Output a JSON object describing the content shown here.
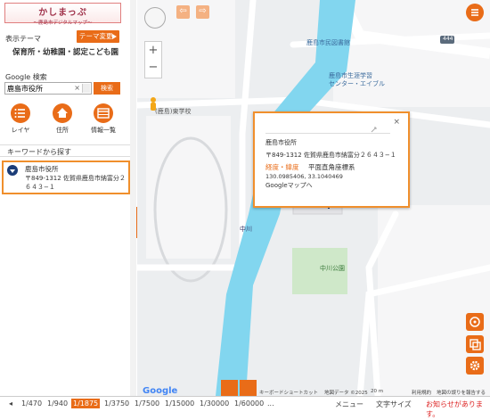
{
  "app": {
    "logo_title": "かしまっぷ",
    "logo_subtitle": "〜鹿島市デジタルマップ〜"
  },
  "sidebar": {
    "theme_label": "表示テーマ",
    "theme_button": "テーマ変更",
    "theme_name": "保育所・幼稚園・認定こども園",
    "google_search_label": "Google 検索",
    "search_value": "鹿島市役所",
    "search_button": "検索",
    "tools": [
      {
        "label": "レイヤ",
        "icon": "list-icon"
      },
      {
        "label": "住所",
        "icon": "home-icon"
      },
      {
        "label": "情報一覧",
        "icon": "table-icon"
      }
    ],
    "keyword_header": "キーワードから探す",
    "result": {
      "name": "鹿島市役所",
      "address": "〒849-1312 佐賀県鹿島市納富分２６４３−１"
    }
  },
  "map": {
    "labels": {
      "library": "鹿島市民図書館",
      "lifelong": "鹿島市生涯学習",
      "lifelong2": "センター・エイブル",
      "school": "(鹿島)東学校",
      "river": "中川",
      "park": "中川公園",
      "route": "444",
      "river_label": "中川"
    },
    "popup": {
      "title": "鹿島市役所",
      "address": "〒849-1312 佐賀県鹿島市納富分２６４３−１",
      "latlon_label": "経度・緯度",
      "coord_system": "平面直角座標系",
      "coords": "130.0985406, 33.1040469",
      "google_link": "Googleマップへ"
    },
    "attribution": {
      "shortcuts": "キーボードショートカット",
      "mapdata": "地図データ ©2025",
      "scale": "20 m",
      "terms": "利用規約",
      "report": "地図の誤りを報告する"
    },
    "google_logo": "Google"
  },
  "footer": {
    "scales": [
      "1/470",
      "1/940",
      "1/1875",
      "1/3750",
      "1/7500",
      "1/15000",
      "1/30000",
      "1/60000"
    ],
    "active_scale": "1/1875",
    "prev": "◂",
    "more": "...",
    "menu": "メニュー",
    "text_size": "文字サイズ",
    "notice": "お知らせがあります。"
  },
  "colors": {
    "accent": "#e96c18",
    "river": "#82d6ef",
    "highlight": "#f08f2c"
  }
}
